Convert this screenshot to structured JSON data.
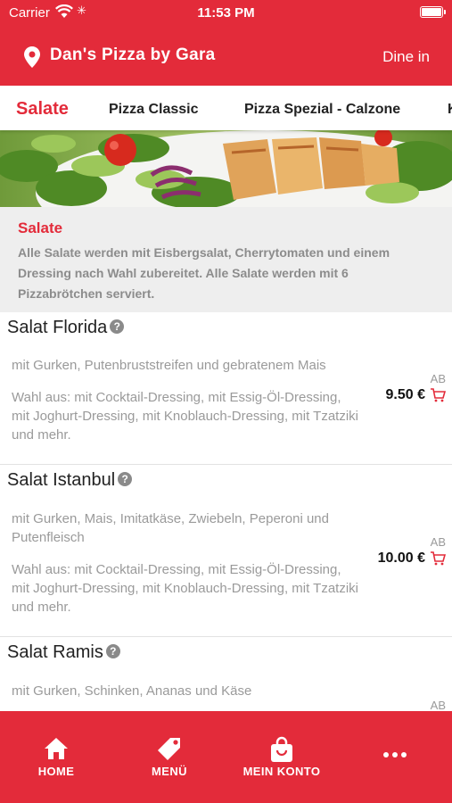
{
  "status": {
    "carrier": "Carrier",
    "time": "11:53 PM"
  },
  "header": {
    "title": "Dan's Pizza by Gara",
    "mode": "Dine in",
    "icon": "location-pin-icon"
  },
  "tabs": [
    {
      "label": "Salate",
      "active": true
    },
    {
      "label": "Pizza Classic",
      "active": false
    },
    {
      "label": "Pizza Spezial - Calzone",
      "active": false
    },
    {
      "label": "K",
      "active": false
    }
  ],
  "category": {
    "name": "Salate",
    "description": "Alle Salate werden mit Eisbergsalat, Cherrytomaten und einem Dressing nach Wahl zubereitet. Alle Salate werden mit 6 Pizzabrötchen serviert."
  },
  "items": [
    {
      "name": "Salat Florida",
      "info_icon": "?",
      "ingredients": "mit Gurken, Putenbruststreifen und gebratenem Mais",
      "options": "Wahl aus: mit Cocktail-Dressing, mit Essig-Öl-Dressing, mit Joghurt-Dressing, mit Knoblauch-Dressing, mit Tzatziki und mehr.",
      "price_prefix": "AB",
      "price": "9.50 €"
    },
    {
      "name": "Salat Istanbul",
      "info_icon": "?",
      "ingredients": "mit Gurken, Mais, Imitatkäse, Zwiebeln, Peperoni und Putenfleisch",
      "options": "Wahl aus: mit Cocktail-Dressing, mit Essig-Öl-Dressing, mit Joghurt-Dressing, mit Knoblauch-Dressing, mit Tzatziki und mehr.",
      "price_prefix": "AB",
      "price": "10.00 €"
    },
    {
      "name": "Salat Ramis",
      "info_icon": "?",
      "ingredients": "mit Gurken, Schinken, Ananas und Käse",
      "options": "",
      "price_prefix": "AB",
      "price": ""
    }
  ],
  "bottom_nav": [
    {
      "label": "HOME",
      "icon": "home-icon"
    },
    {
      "label": "MENÜ",
      "icon": "tag-icon"
    },
    {
      "label": "MEIN KONTO",
      "icon": "shopping-bag-icon"
    },
    {
      "label": "",
      "icon": "more-dots-icon"
    }
  ],
  "colors": {
    "brand": "#e32b3a",
    "category_bg": "#eeeeee",
    "muted_text": "#9a9a9a"
  }
}
